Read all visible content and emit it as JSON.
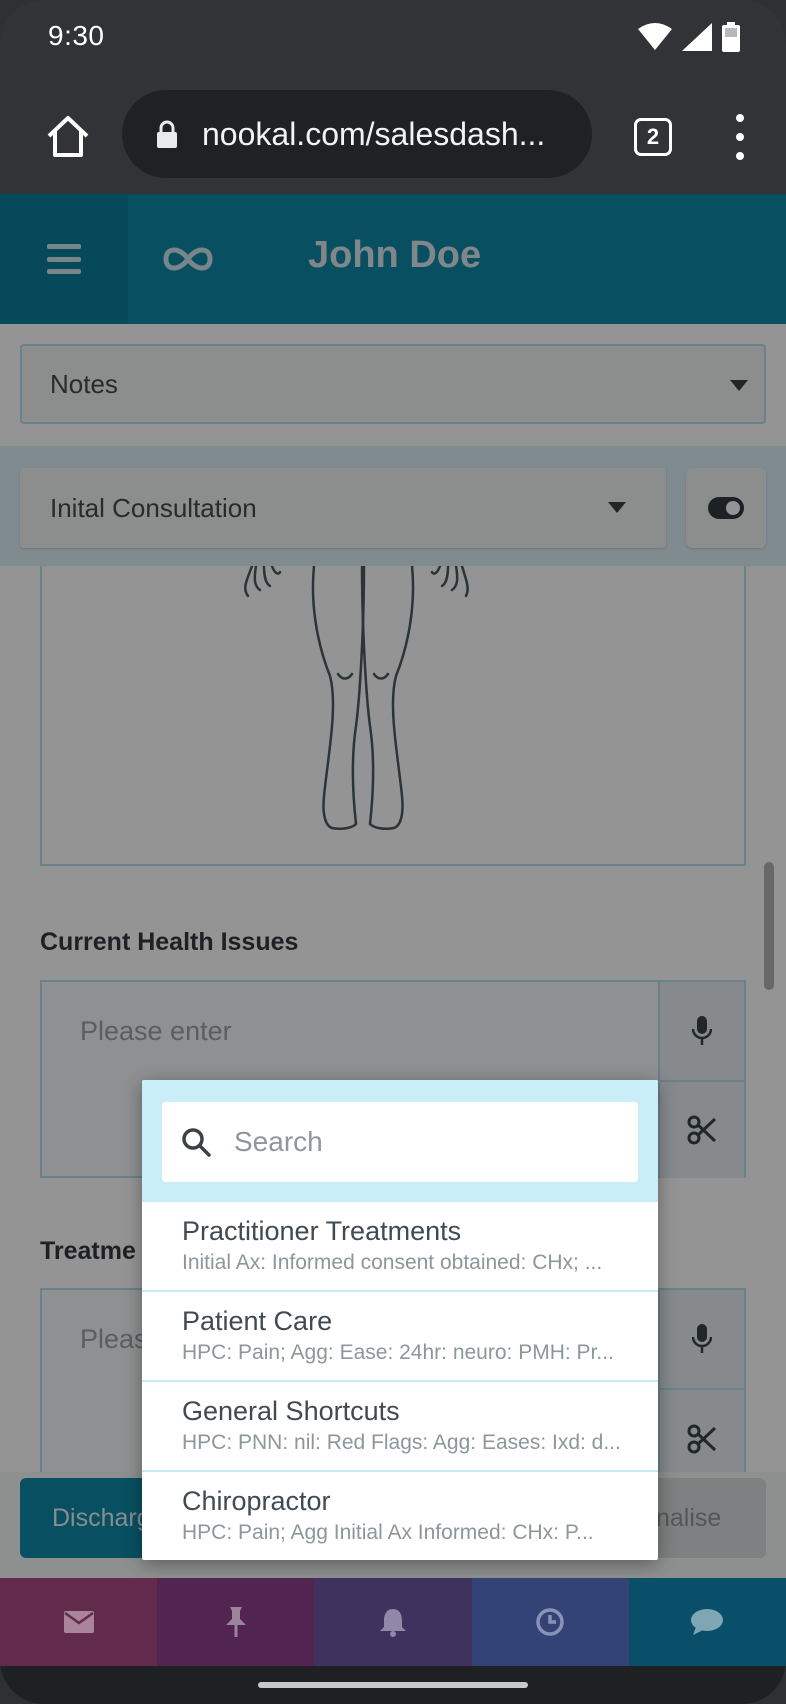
{
  "status_bar": {
    "time": "9:30"
  },
  "browser": {
    "url": "nookal.com/salesdash...",
    "tab_count": "2"
  },
  "app": {
    "title": "John Doe",
    "notes_select": "Notes",
    "consultation_select": "Inital Consultation",
    "sections": [
      {
        "label": "Current Health Issues",
        "placeholder": "Please enter"
      },
      {
        "label": "Treatme",
        "placeholder": "Pleas"
      }
    ],
    "actions": {
      "discharge": "Discharg",
      "finalise": "nalise"
    }
  },
  "popup": {
    "search_placeholder": "Search",
    "items": [
      {
        "title": "Practitioner Treatments",
        "subtitle": "Initial Ax: Informed consent obtained: CHx; ..."
      },
      {
        "title": "Patient Care",
        "subtitle": "HPC: Pain; Agg: Ease: 24hr: neuro: PMH: Pr..."
      },
      {
        "title": "General Shortcuts",
        "subtitle": "HPC: PNN: nil: Red Flags: Agg: Eases: Ixd: d..."
      },
      {
        "title": "Chiropractor",
        "subtitle": "HPC: Pain; Agg Initial Ax Informed: CHx: P..."
      }
    ]
  },
  "bottom_nav": {
    "icons": [
      "mail-icon",
      "pin-icon",
      "bell-icon",
      "clock-icon",
      "chat-icon"
    ],
    "colors": [
      "#9c3a6b",
      "#7a2d6e",
      "#5d3b86",
      "#4a5aa8",
      "#0d8aa6"
    ]
  },
  "colors": {
    "header": "#0f8aa8",
    "accent_light": "#c9eef8"
  }
}
